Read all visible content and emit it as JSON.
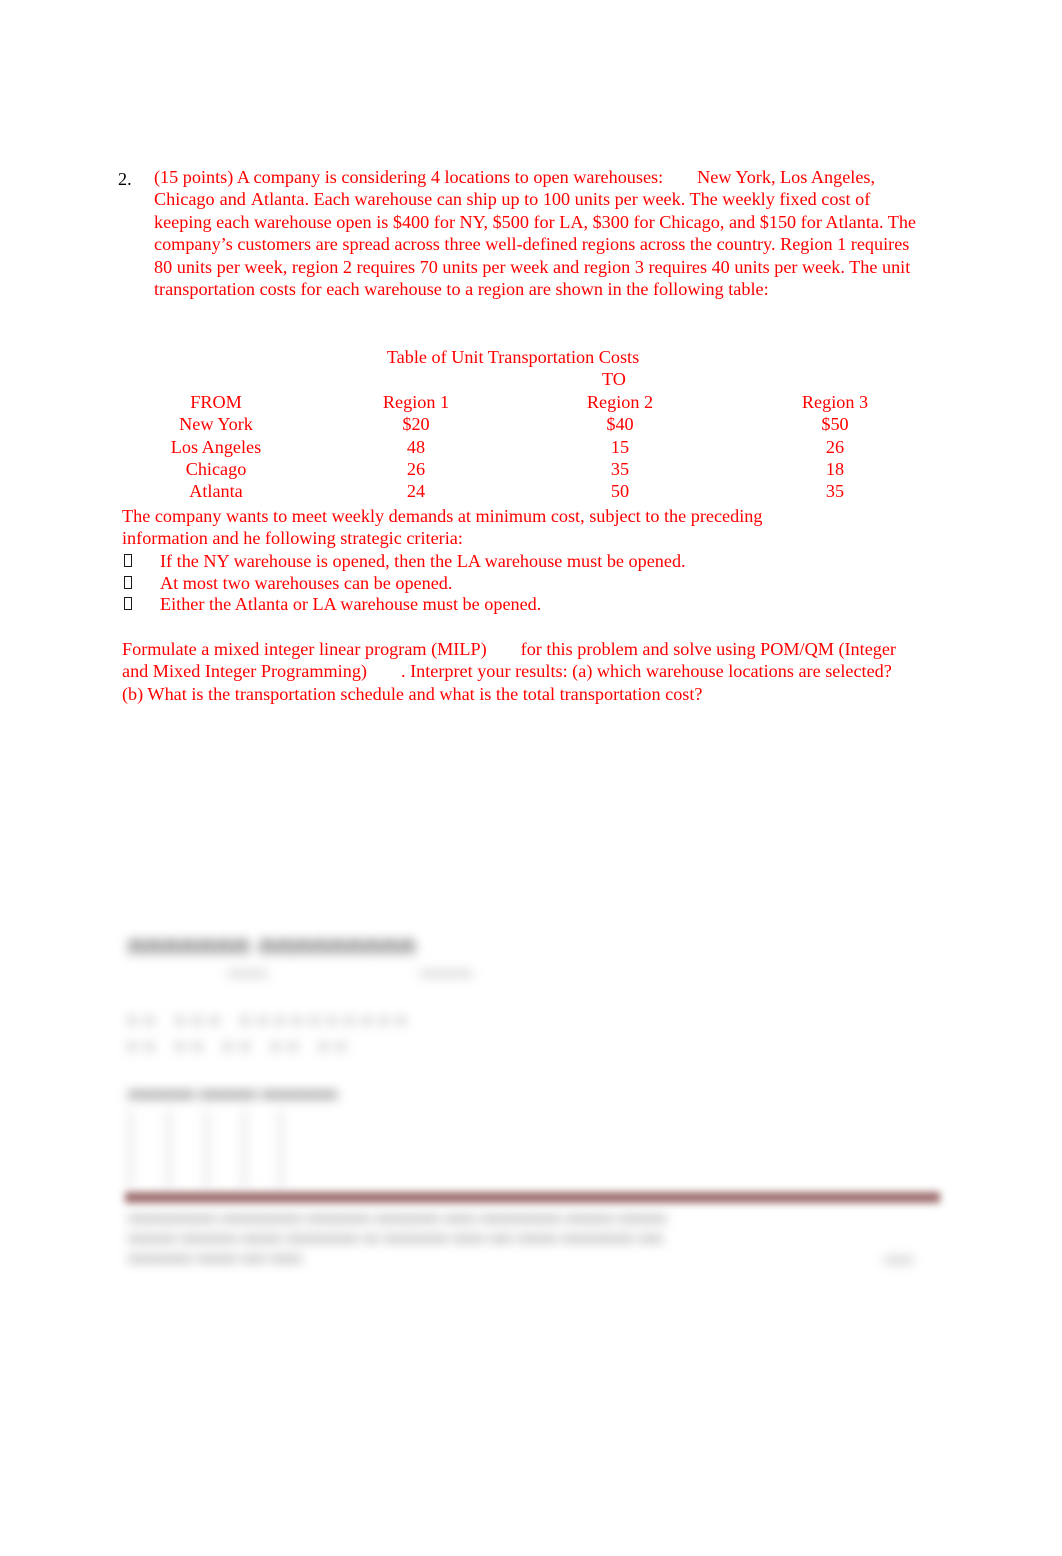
{
  "document": {
    "accent_color": "#FF0000",
    "number_color": "#000000",
    "background": "#ffffff"
  },
  "question": {
    "number": "2.",
    "line1_a": "(15 points) A company is considering 4 locations to open warehouses:",
    "line1_b": "New York",
    "line1_c": ", Los Angeles",
    "line1_d": ",",
    "line2_a": "Chicago",
    "line2_b": "and",
    "line2_c": "Atlanta",
    "line2_d": ". Each warehouse can ship up to 100 units per week. The weekly fixed cost",
    "rest": "of keeping each warehouse open is $400 for NY, $500 for LA, $300 for Chicago, and $150 for Atlanta. The company’s customers are spread across three well-defined regions across the country. Region 1 requires 80 units per week, region 2 requires 70 units per week and region 3 requires 40 units per week. The unit transportation costs for each warehouse to a region are shown in the following table:"
  },
  "cost_table": {
    "title": "Table of Unit Transportation Costs",
    "to_label": "TO",
    "columns": [
      "FROM",
      "Region 1",
      "Region 2",
      "Region 3"
    ],
    "rows": [
      {
        "from": "New York",
        "region1": "$20",
        "region2": "$40",
        "region3": "$50"
      },
      {
        "from": "Los Angeles",
        "region1": "48",
        "region2": "15",
        "region3": "26"
      },
      {
        "from": "Chicago",
        "region1": "26",
        "region2": "35",
        "region3": "18"
      },
      {
        "from": "Atlanta",
        "region1": "24",
        "region2": "50",
        "region3": "35"
      }
    ]
  },
  "criteria": {
    "intro_line1": "The  company  wants  to  meet  weekly  demands  at  minimum  cost,  subject  to  the  preceding",
    "intro_line2": "information and he following strategic criteria:",
    "items": [
      "If the NY warehouse is opened, then the LA warehouse must be opened.",
      "At most  two warehouses can be opened.",
      "Either the Atlanta or LA warehouse must be opened."
    ]
  },
  "closing": {
    "part_a": "Formulate a mixed integer linear program (MILP)",
    "part_b": "for this problem and solve using POM/QM",
    "part_c": "(Integer and Mixed Integer Programming)",
    "part_d": ". Interpret your results: (a) which warehouse locations",
    "part_e": "are selected? (b) What is the transportation schedule and what is the total transportation cost?"
  },
  "obscured": {
    "heading": "nnnnnnn  nnnnnnnnn",
    "sub1": "nnnnnn",
    "sub2": "nnnnnnnn",
    "row1": "nn nnn nnnnnnnnnn",
    "row2": "nn nn nn nn nn",
    "subheading": "nnnnnnn nnnnnn nnnnnnnn",
    "para1": "nnnnnnnnnnn nnnnnnnnnn nnnnnnnn nnnnnnnn nnnn nnnnnnnnnn nnnnnn nnnnnn",
    "para2": "nnnnnn nnnnnnn nnnnn nnnnnnnnn nn nnnnnnnn nnnn nnn nnnnn nnnnnnnnn nnn",
    "para3": "nnnnnnnn nnnnn nnn nnnn",
    "corner": "nnnn"
  }
}
